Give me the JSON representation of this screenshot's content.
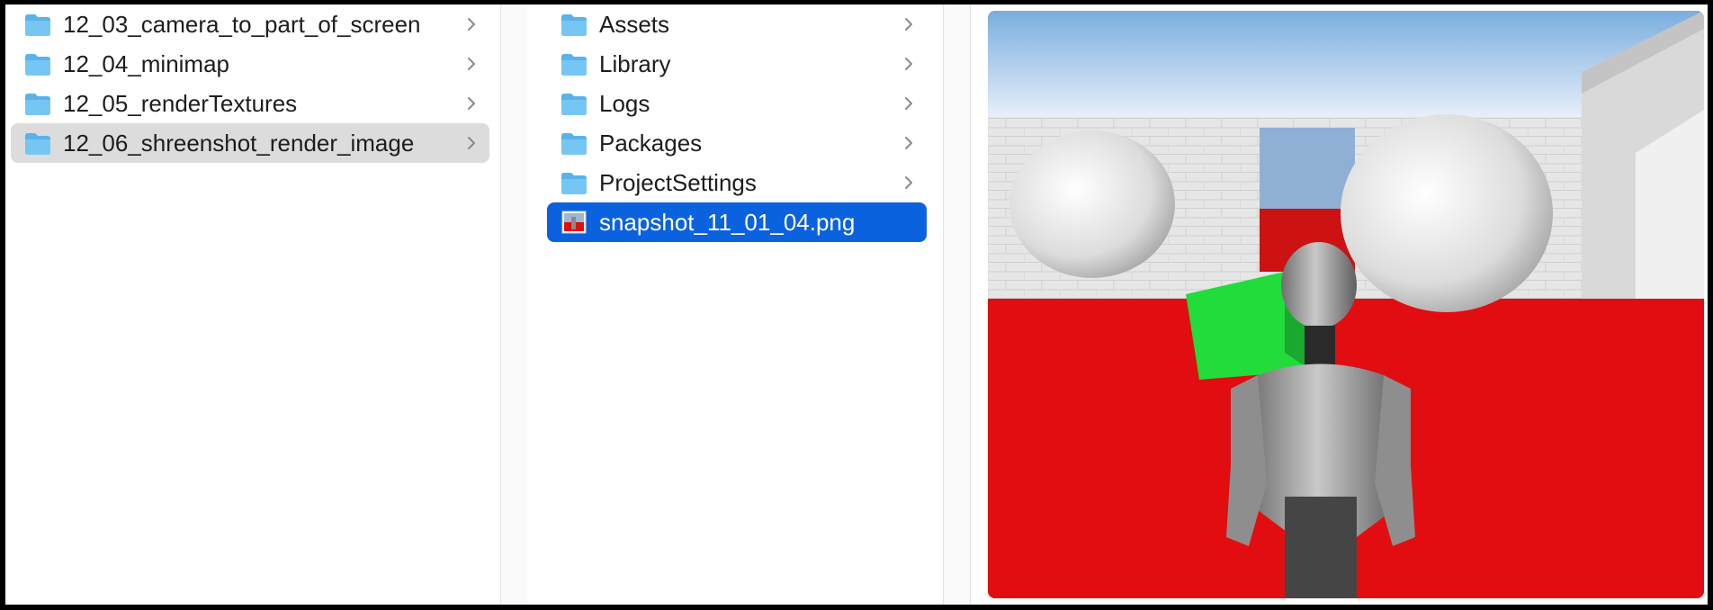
{
  "column1": {
    "items": [
      {
        "label": "12_03_camera_to_part_of_screen",
        "type": "folder"
      },
      {
        "label": "12_04_minimap",
        "type": "folder"
      },
      {
        "label": "12_05_renderTextures",
        "type": "folder"
      },
      {
        "label": "12_06_shreenshot_render_image",
        "type": "folder",
        "selected": true
      }
    ]
  },
  "column2": {
    "items": [
      {
        "label": "Assets",
        "type": "folder"
      },
      {
        "label": "Library",
        "type": "folder"
      },
      {
        "label": "Logs",
        "type": "folder"
      },
      {
        "label": "Packages",
        "type": "folder"
      },
      {
        "label": "ProjectSettings",
        "type": "folder"
      },
      {
        "label": "snapshot_11_01_04.png",
        "type": "image-file",
        "selected": true
      }
    ]
  },
  "preview": {
    "description_icon": "image-preview",
    "colors": {
      "sky_top": "#7aaede",
      "sky_bottom": "#f2f6fb",
      "wall": "#e6e6e6",
      "floor": "#e10d10",
      "cube": "#21dc3a",
      "selection_blue": "#0a62de",
      "folder_blue": "#5ab2e9"
    }
  },
  "icons": {
    "folder": "folder-icon",
    "image_file": "png-file-icon",
    "chevron": "chevron-right-icon"
  }
}
